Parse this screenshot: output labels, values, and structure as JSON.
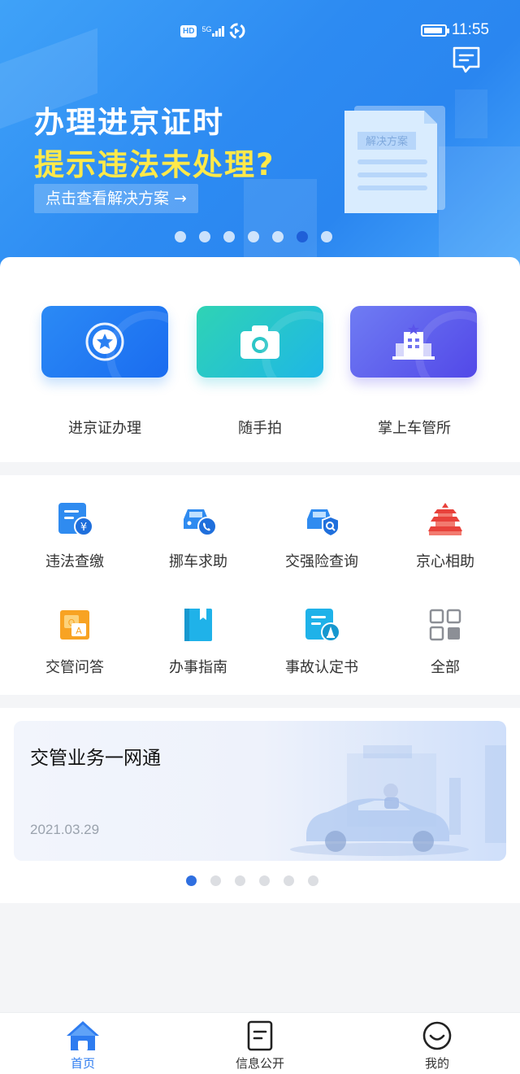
{
  "status_bar": {
    "hd_label": "HD",
    "network_label": "5G",
    "time": "11:55"
  },
  "hero": {
    "headline_line1": "办理进京证时",
    "headline_line2": "提示违法未处理?",
    "cta_label": "点击查看解决方案 →",
    "doc_label": "解决方案",
    "slide_count": 7,
    "active_slide": 6
  },
  "shortcuts": [
    {
      "label": "进京证办理",
      "icon": "star-badge-icon",
      "color_start": "#2b8af5",
      "color_end": "#1a6cf0"
    },
    {
      "label": "随手拍",
      "icon": "camera-icon",
      "color_start": "#2fd3b4",
      "color_end": "#1eb7e6"
    },
    {
      "label": "掌上车管所",
      "icon": "office-building-icon",
      "color_start": "#6f7cf3",
      "color_end": "#5248e8"
    }
  ],
  "services": [
    {
      "label": "违法查缴",
      "icon": "fine-payment-icon"
    },
    {
      "label": "挪车求助",
      "icon": "car-call-icon"
    },
    {
      "label": "交强险查询",
      "icon": "car-insurance-search-icon"
    },
    {
      "label": "京心相助",
      "icon": "temple-of-heaven-icon"
    },
    {
      "label": "交管问答",
      "icon": "qa-chat-icon"
    },
    {
      "label": "办事指南",
      "icon": "guide-book-icon"
    },
    {
      "label": "事故认定书",
      "icon": "accident-report-icon"
    },
    {
      "label": "全部",
      "icon": "grid-all-icon"
    }
  ],
  "news": {
    "title": "交管业务一网通",
    "date": "2021.03.29",
    "slide_count": 6,
    "active_slide": 1
  },
  "tabs": [
    {
      "label": "首页",
      "icon": "home-icon",
      "active": true
    },
    {
      "label": "信息公开",
      "icon": "document-icon",
      "active": false
    },
    {
      "label": "我的",
      "icon": "smiley-face-icon",
      "active": false
    }
  ],
  "colors": {
    "primary_blue": "#2e7cf0",
    "headline_yellow": "#ffe94a",
    "icon_blue": "#2f8bf0",
    "icon_red": "#e8423b",
    "icon_orange": "#f8a323"
  }
}
